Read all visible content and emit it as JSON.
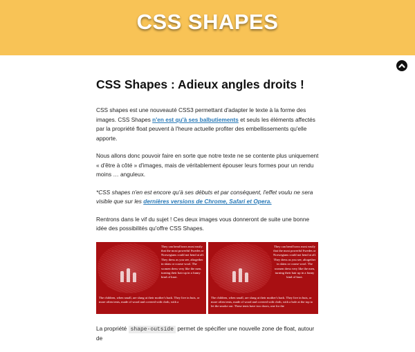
{
  "header": {
    "title": "CSS SHAPES"
  },
  "back_to_top": {
    "icon": "chevron-up-icon"
  },
  "article": {
    "heading": "CSS Shapes : Adieux angles droits !",
    "p1": {
      "before": "CSS shapes est une nouveauté CSS3 permettant d'adapter le texte à la forme des images. CSS Shapes ",
      "link": "n'en est qu'à ses balbutiements",
      "after": " et seuls les éléments affectés par la propriété float peuvent à l'heure actuelle profiter des embellissements qu'elle apporte."
    },
    "p2": "Nous allons donc pouvoir faire en sorte que notre texte ne se contente plus uniquement « d'être à côté » d'images, mais de véritablement épouser leurs formes pour un rendu moins … anguleux.",
    "p3": {
      "before": "*CSS shapes n'en est encore qu'à ses débuts et par conséquent, l'effet voulu ne sera visible que sur les ",
      "link": "dernières versions de Chrome, Safari et Opera.",
      "after": ""
    },
    "p4": "Rentrons dans le vif du sujet ! Ces deux images vous donneront de suite une bonne idée des possibilités qu'offre CSS Shapes.",
    "images": [
      {
        "side_text": "They can bend bows most easily that the most powerful Swedes or Norwegians could not bend at all. They dress as you see, altogether in skins or coarse wool. The women dress very like the men, turning their hair up in a funny kind of knot.",
        "bottom_text": "The children, when small, are slung at their mother's back. They live in huts, or more often tents, made of wood and covered with cloth, with a"
      },
      {
        "side_text": "They can bend bows most easily that the most powerful Swedes or Norwegians could not bend at all. They dress as you see, altogether in skins or coarse wool. The women dress very like the men, turning their hair up in a funny kind of knot.",
        "bottom_text": "The children, when small, are slung at their mother's back. They live in huts, or more often tents, made of wood and covered with cloth, with a hole at the top to let the smoke out. These tents have two doors, one for the"
      }
    ],
    "p5": {
      "before": "La propriété ",
      "code": "shape-outside",
      "after": " permet de spécifier une nouvelle zone de float, autour de"
    }
  },
  "colors": {
    "banner": "#f8c356",
    "image_bg": "#a80f12",
    "link": "#2a7ab8"
  }
}
